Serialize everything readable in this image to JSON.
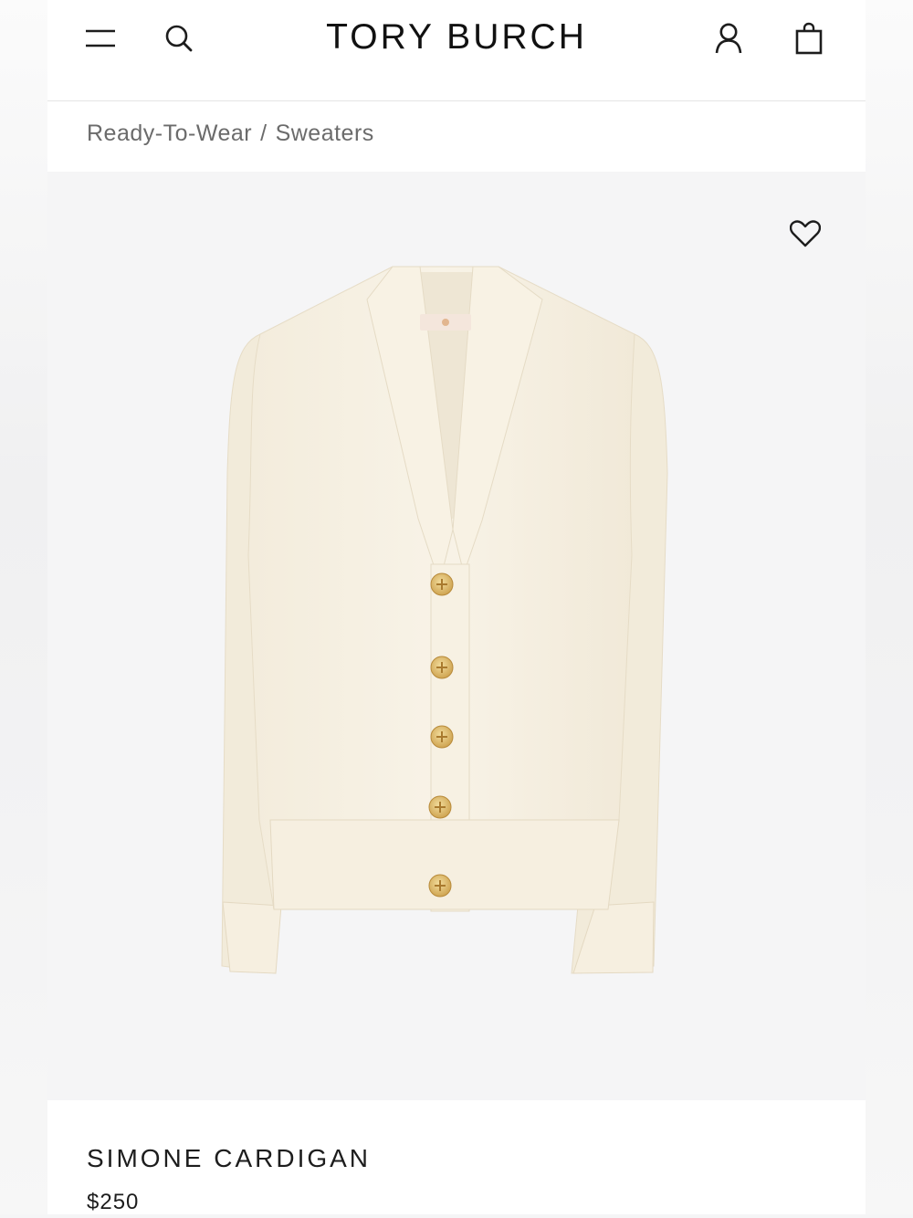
{
  "header": {
    "brand": "TORY BURCH",
    "icons": {
      "menu": "hamburger-menu-icon",
      "search": "search-icon",
      "account": "user-icon",
      "bag": "shopping-bag-icon"
    }
  },
  "breadcrumb": {
    "items": [
      "Ready-To-Wear",
      "Sweaters"
    ],
    "separator": "/"
  },
  "product": {
    "image_alt": "Simone Cardigan in ivory with gold logo buttons",
    "wishlist_icon": "heart-icon",
    "name": "SIMONE CARDIGAN",
    "price": "$250"
  },
  "colors": {
    "background": "#f5f5f6",
    "text": "#1d1d1d",
    "breadcrumb": "#6b6b6b",
    "garment": "#f7f1e3",
    "button_gold": "#d9b86a"
  }
}
